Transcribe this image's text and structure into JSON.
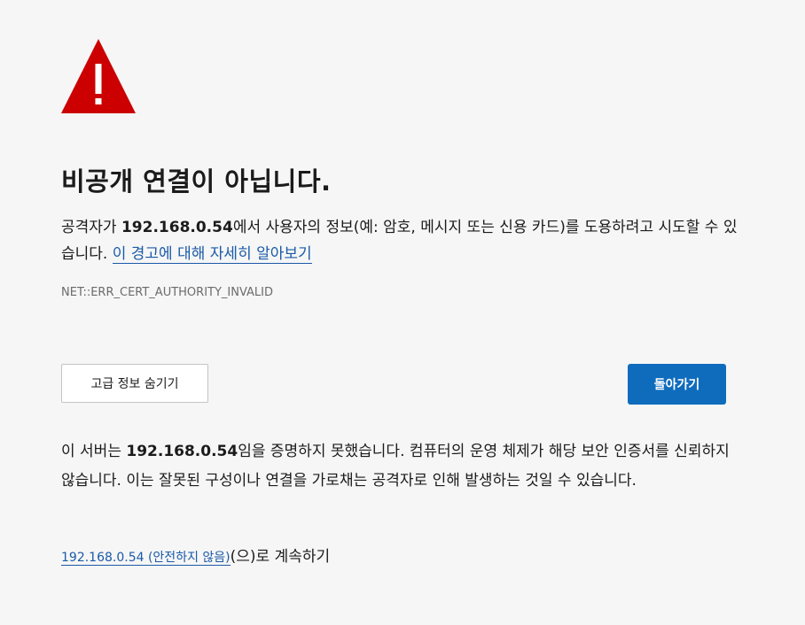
{
  "icon": {
    "name": "warning-triangle-icon",
    "color": "#cc0000",
    "glyph": "!"
  },
  "heading": "비공개 연결이 아닙니다.",
  "intro": {
    "prefix": "공격자가 ",
    "host": "192.168.0.54",
    "suffix": "에서 사용자의 정보(예: 암호, 메시지 또는 신용 카드)를 도용하려고 시도할 수 있습니다. ",
    "learn_more_link": "이 경고에 대해 자세히 알아보기"
  },
  "error_code": "NET::ERR_CERT_AUTHORITY_INVALID",
  "buttons": {
    "advanced_label": "고급 정보 숨기기",
    "back_label": "돌아가기"
  },
  "details": {
    "prefix": "이 서버는 ",
    "host": "192.168.0.54",
    "suffix": "임을 증명하지 못했습니다. 컴퓨터의 운영 체제가 해당 보안 인증서를 신뢰하지 않습니다. 이는 잘못된 구성이나 연결을 가로채는 공격자로 인해 발생하는 것일 수 있습니다."
  },
  "proceed": {
    "link": "192.168.0.54 (안전하지 않음)",
    "suffix": "(으)로 계속하기"
  },
  "colors": {
    "background": "#f6f6f6",
    "link": "#1a5aa8",
    "primary_button": "#0f6cbd",
    "warning": "#cc0000"
  }
}
